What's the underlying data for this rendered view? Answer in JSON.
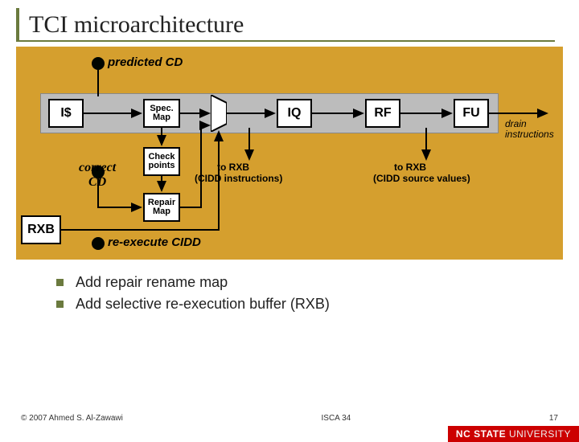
{
  "title": "TCI microarchitecture",
  "diagram": {
    "predicted": "predicted CD",
    "correct": "correct\nCD",
    "reexec": "re-execute CIDD",
    "drain": "drain\ninstructions",
    "toRXB1_a": "to RXB",
    "toRXB1_b": "(CIDD instructions)",
    "toRXB2_a": "to RXB",
    "toRXB2_b": "(CIDD source values)",
    "stages": {
      "is": "I$",
      "specmap": "Spec.\nMap",
      "iq": "IQ",
      "rf": "RF",
      "fu": "FU",
      "checkpoints": "Check\npoints",
      "repairmap": "Repair\nMap",
      "rxb": "RXB"
    }
  },
  "bullets": {
    "b1": "Add repair rename map",
    "b2": "Add selective re-execution buffer (RXB)"
  },
  "footer": {
    "left": "© 2007 Ahmed S. Al-Zawawi",
    "center": "ISCA 34",
    "right": "17",
    "brand_bold": "NC STATE",
    "brand_thin": " UNIVERSITY"
  }
}
